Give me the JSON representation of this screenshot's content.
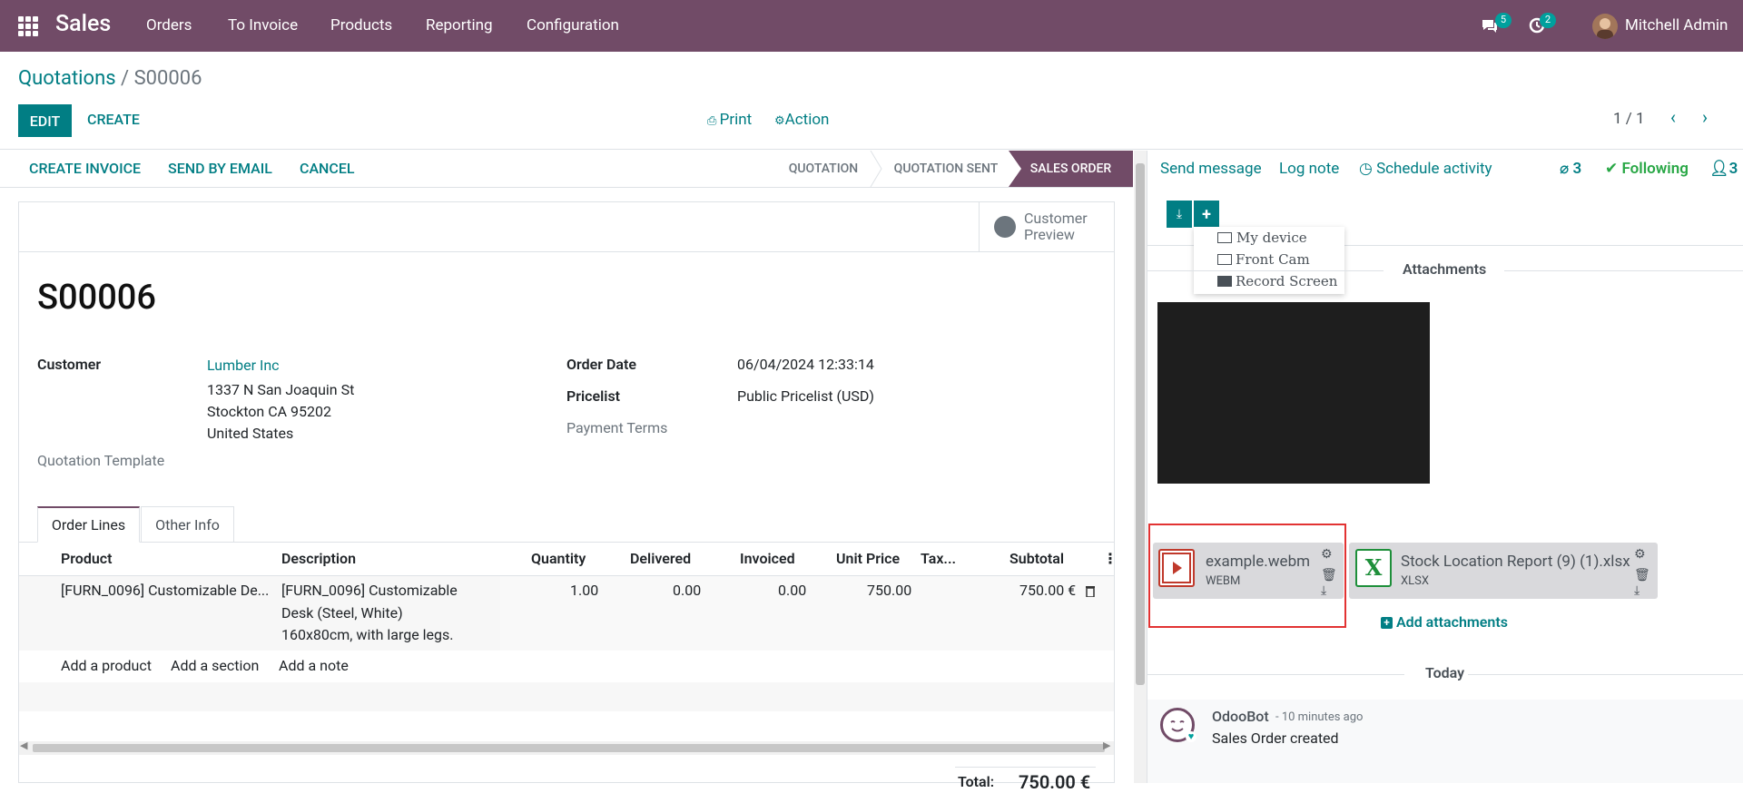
{
  "topbar": {
    "app": "Sales",
    "menu": [
      "Orders",
      "To Invoice",
      "Products",
      "Reporting",
      "Configuration"
    ],
    "messages_count": "5",
    "activities_count": "2",
    "user": "Mitchell Admin"
  },
  "breadcrumb": {
    "parent": "Quotations",
    "sep": " / ",
    "current": "S00006"
  },
  "control": {
    "edit": "EDIT",
    "create": "CREATE",
    "print": "Print",
    "action": "Action",
    "pager": "1 / 1"
  },
  "statusbar": {
    "buttons": [
      "CREATE INVOICE",
      "SEND BY EMAIL",
      "CANCEL"
    ],
    "stages": [
      "QUOTATION",
      "QUOTATION SENT",
      "SALES ORDER"
    ],
    "active_stage": "SALES ORDER"
  },
  "form": {
    "preview": [
      "Customer",
      "Preview"
    ],
    "name": "S00006",
    "customer_label": "Customer",
    "customer_name": "Lumber Inc",
    "address": [
      "1337 N San Joaquin St",
      "Stockton CA 95202",
      "United States"
    ],
    "template_label": "Quotation Template",
    "order_date_label": "Order Date",
    "order_date": "06/04/2024 12:33:14",
    "pricelist_label": "Pricelist",
    "pricelist": "Public Pricelist (USD)",
    "payment_terms_label": "Payment Terms",
    "tabs": [
      "Order Lines",
      "Other Info"
    ],
    "columns": [
      "Product",
      "Description",
      "Quantity",
      "Delivered",
      "Invoiced",
      "Unit Price",
      "Tax...",
      "Subtotal"
    ],
    "rows": [
      {
        "product": "[FURN_0096] Customizable De...",
        "description": [
          "[FURN_0096] Customizable",
          "Desk (Steel, White)",
          "160x80cm, with large legs."
        ],
        "quantity": "1.00",
        "delivered": "0.00",
        "invoiced": "0.00",
        "unit_price": "750.00",
        "subtotal": "750.00 €"
      }
    ],
    "add_links": [
      "Add a product",
      "Add a section",
      "Add a note"
    ],
    "total_label": "Total:",
    "total_value": "750.00 €"
  },
  "chatter": {
    "send_message": "Send message",
    "log_note": "Log note",
    "schedule": "Schedule activity",
    "attachments_count": "3",
    "following": "Following",
    "followers_count": "3",
    "upload_menu": [
      "My device",
      "Front Cam",
      "Record Screen"
    ],
    "attachments_title": "Attachments",
    "files": [
      {
        "name": "example.webm",
        "type": "WEBM"
      },
      {
        "name": "Stock Location Report (9) (1).xlsx",
        "type": "XLSX"
      }
    ],
    "add_attachments": "Add attachments",
    "today": "Today",
    "message": {
      "author": "OdooBot",
      "time": "- 10 minutes ago",
      "body": "Sales Order created"
    }
  },
  "colors": {
    "brand": "#714b67",
    "accent": "#017e84",
    "highlight": "#e23333"
  }
}
